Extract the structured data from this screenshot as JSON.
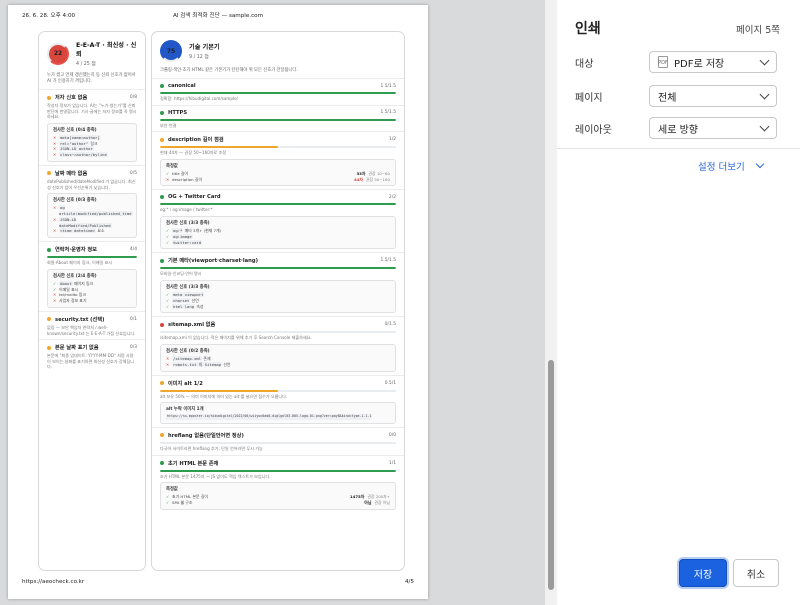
{
  "page": {
    "date": "26. 6. 28. 오후 4:00",
    "title": "AI 검색 최적화 진단 — sample.com",
    "footer_url": "https://aeocheck.co.kr",
    "page_number": "4/5"
  },
  "left_card": {
    "score": "22",
    "title": "E-E-A-T · 최신성 · 신뢰",
    "subtitle": "4 / 25 점",
    "desc": "누가 썼고 언제 갱신했는지 등 신뢰 신호가 없어서 AI 가 인용하기 꺼립니다.",
    "sections": [
      {
        "title": "저자 신호 없음",
        "score": "0/8",
        "desc": "작성자 정보가 없습니다. AI는 \"누가 썼는가\"를 신뢰 판단에 반영합니다. 기사·글에는 저자 정보를 꼭 명시하세요.",
        "box_title": "검사한 신호 (0/4 충족)",
        "items": [
          {
            "ok": false,
            "code": "meta[name=author]",
            "text": ""
          },
          {
            "ok": false,
            "code": "rel=\"author\"",
            "text": "링크"
          },
          {
            "ok": false,
            "code": "JSON-LD author",
            "text": ""
          },
          {
            "ok": false,
            "code": "class~=author/byline",
            "text": ""
          }
        ]
      },
      {
        "title": "날짜 메타 없음",
        "score": "0/5",
        "desc": "datePublished/dateModified 가 없습니다. 최신성 신호가 없어 우선순위가 낮습니다.",
        "box_title": "검사한 신호 (0/3 충족)",
        "items": [
          {
            "ok": false,
            "code": "og article:modified/published_time",
            "text": ""
          },
          {
            "ok": false,
            "code": "JSON-LD dateModified/Published",
            "text": ""
          },
          {
            "ok": false,
            "code": "<time datetime>",
            "text": "요소"
          }
        ]
      },
      {
        "title": "연락처·운영자 정보",
        "score": "4/4",
        "desc": "회원·About 페이지 링크, 이메일 표시",
        "box_title": "검사한 신호 (2/4 충족)",
        "items": [
          {
            "ok": true,
            "code": "About",
            "text": "페이지 링크"
          },
          {
            "ok": true,
            "code": "",
            "text": "이메일 표시"
          },
          {
            "ok": false,
            "code": "",
            "text": "tel/mailto 링크"
          },
          {
            "ok": false,
            "code": "",
            "text": "사업자 정보 표기"
          }
        ]
      },
      {
        "title": "security.txt (선택)",
        "score": "0/1",
        "desc": "없음 — 보안 책임자 연락처 /.well-known/security.txt 는 E-E-A-T 가점 신호입니다."
      },
      {
        "title": "본문 날짜 표기 없음",
        "score": "0/3",
        "desc": "본문에 \"최종 업데이트: YYYY-MM-DD\" 처럼 사람이 보이는 날짜를 표기하면 최신성 신호가 강해집니다."
      }
    ]
  },
  "right_card": {
    "score": "75",
    "title": "기술 기본기",
    "subtitle": "9 / 12 점",
    "desc": "크롤링·색인·초기 HTML 같은 기본기가 탄탄해야 위 모든 신호가 전달됩니다.",
    "sections": [
      {
        "title": "canonical",
        "score": "1.5/1.5",
        "fill": 1,
        "color": "green",
        "desc": "정확함: https://hibudigital.com/sample/"
      },
      {
        "title": "HTTPS",
        "score": "1.5/1.5",
        "fill": 1,
        "color": "green",
        "desc": "보안 연결"
      },
      {
        "title": "description 길이 점검",
        "score": "1/2",
        "fill": 0.5,
        "color": "orange",
        "desc": "현재 44자 — 권장 50~160자로 조정",
        "box_title": "측정값",
        "measures": [
          {
            "ok": true,
            "label": "title 길이",
            "value": "33자",
            "note": "권장 10~60"
          },
          {
            "ok": false,
            "label": "description 길이",
            "value": "44자",
            "note": "권장 50~160"
          }
        ]
      },
      {
        "title": "OG + Twitter Card",
        "score": "2/2",
        "fill": 1,
        "color": "green",
        "desc": "og:* / og:image / twitter:*",
        "box_title": "검사한 신호 (3/3 충족)",
        "items": [
          {
            "ok": true,
            "code": "og:*",
            "text": "메타 3개+ (현재 7개)"
          },
          {
            "ok": true,
            "code": "og:image",
            "text": ""
          },
          {
            "ok": true,
            "code": "twitter:card",
            "text": ""
          }
        ]
      },
      {
        "title": "기본 메타(viewport·charset·lang)",
        "score": "1.5/1.5",
        "fill": 1,
        "color": "green",
        "desc": "모바일·인코딩·언어 명시",
        "box_title": "검사한 신호 (3/3 충족)",
        "items": [
          {
            "ok": true,
            "code": "meta viewport",
            "text": ""
          },
          {
            "ok": true,
            "code": "charset",
            "text": "선언"
          },
          {
            "ok": true,
            "code": "html lang",
            "text": "속성"
          }
        ]
      },
      {
        "title": "sitemap.xml 없음",
        "score": "0/1.5",
        "fill": 0,
        "color": "red",
        "desc": "/sitemap.xml 이 없습니다. 적은 페이지를 위해 추가 후 Search Console 제출하세요.",
        "box_title": "검사한 신호 (0/2 충족)",
        "items": [
          {
            "ok": false,
            "code": "/sitemap.xml",
            "text": "존재"
          },
          {
            "ok": false,
            "code": "robots.txt 의 Sitemap",
            "text": "선언"
          }
        ]
      },
      {
        "title": "이미지 alt 1/2",
        "score": "0.5/1",
        "fill": 0.5,
        "color": "orange",
        "desc": "alt 보유 50% — 의미 이미지에 의미 있는 alt 를 넣으면 점수가 오릅니다.",
        "box_title": "alt 누락 이미지 1개",
        "long_item": "https://ss.mposter.io/hibudigital/2022/06/wiiyun0ad0-diglgol03-005-logo-01.png?ver=pay8&kind=type-1.1.1"
      },
      {
        "title": "hreflang 없음(단일언어면 정상)",
        "score": "0/0",
        "fill": 0,
        "color": "orange",
        "desc": "다국어 사이트라면 hreflang 추가, 단일 언어라면 무시 가능"
      },
      {
        "title": "초기 HTML 본문 존재",
        "score": "1/1",
        "fill": 1,
        "color": "green",
        "desc": "초기 HTML 본문 1475자 — JS 없이도 핵심 텍스트가 보입니다.",
        "box_title": "측정값",
        "measures": [
          {
            "ok": true,
            "label": "초기 HTML 본문 길이",
            "value": "1475자",
            "note": "권장 200자+"
          },
          {
            "ok": true,
            "label": "SPA 쉘 구조",
            "value": "아님",
            "note": "권장 아님"
          }
        ]
      }
    ]
  },
  "print": {
    "title": "인쇄",
    "pages": "페이지 5쪽",
    "destination_label": "대상",
    "destination_value": "PDF로 저장",
    "pdf_icon_text": "PDF",
    "pages_label": "페이지",
    "pages_value": "전체",
    "layout_label": "레이아웃",
    "layout_value": "세로 방향",
    "more_settings": "설정 더보기",
    "save": "저장",
    "cancel": "취소"
  }
}
